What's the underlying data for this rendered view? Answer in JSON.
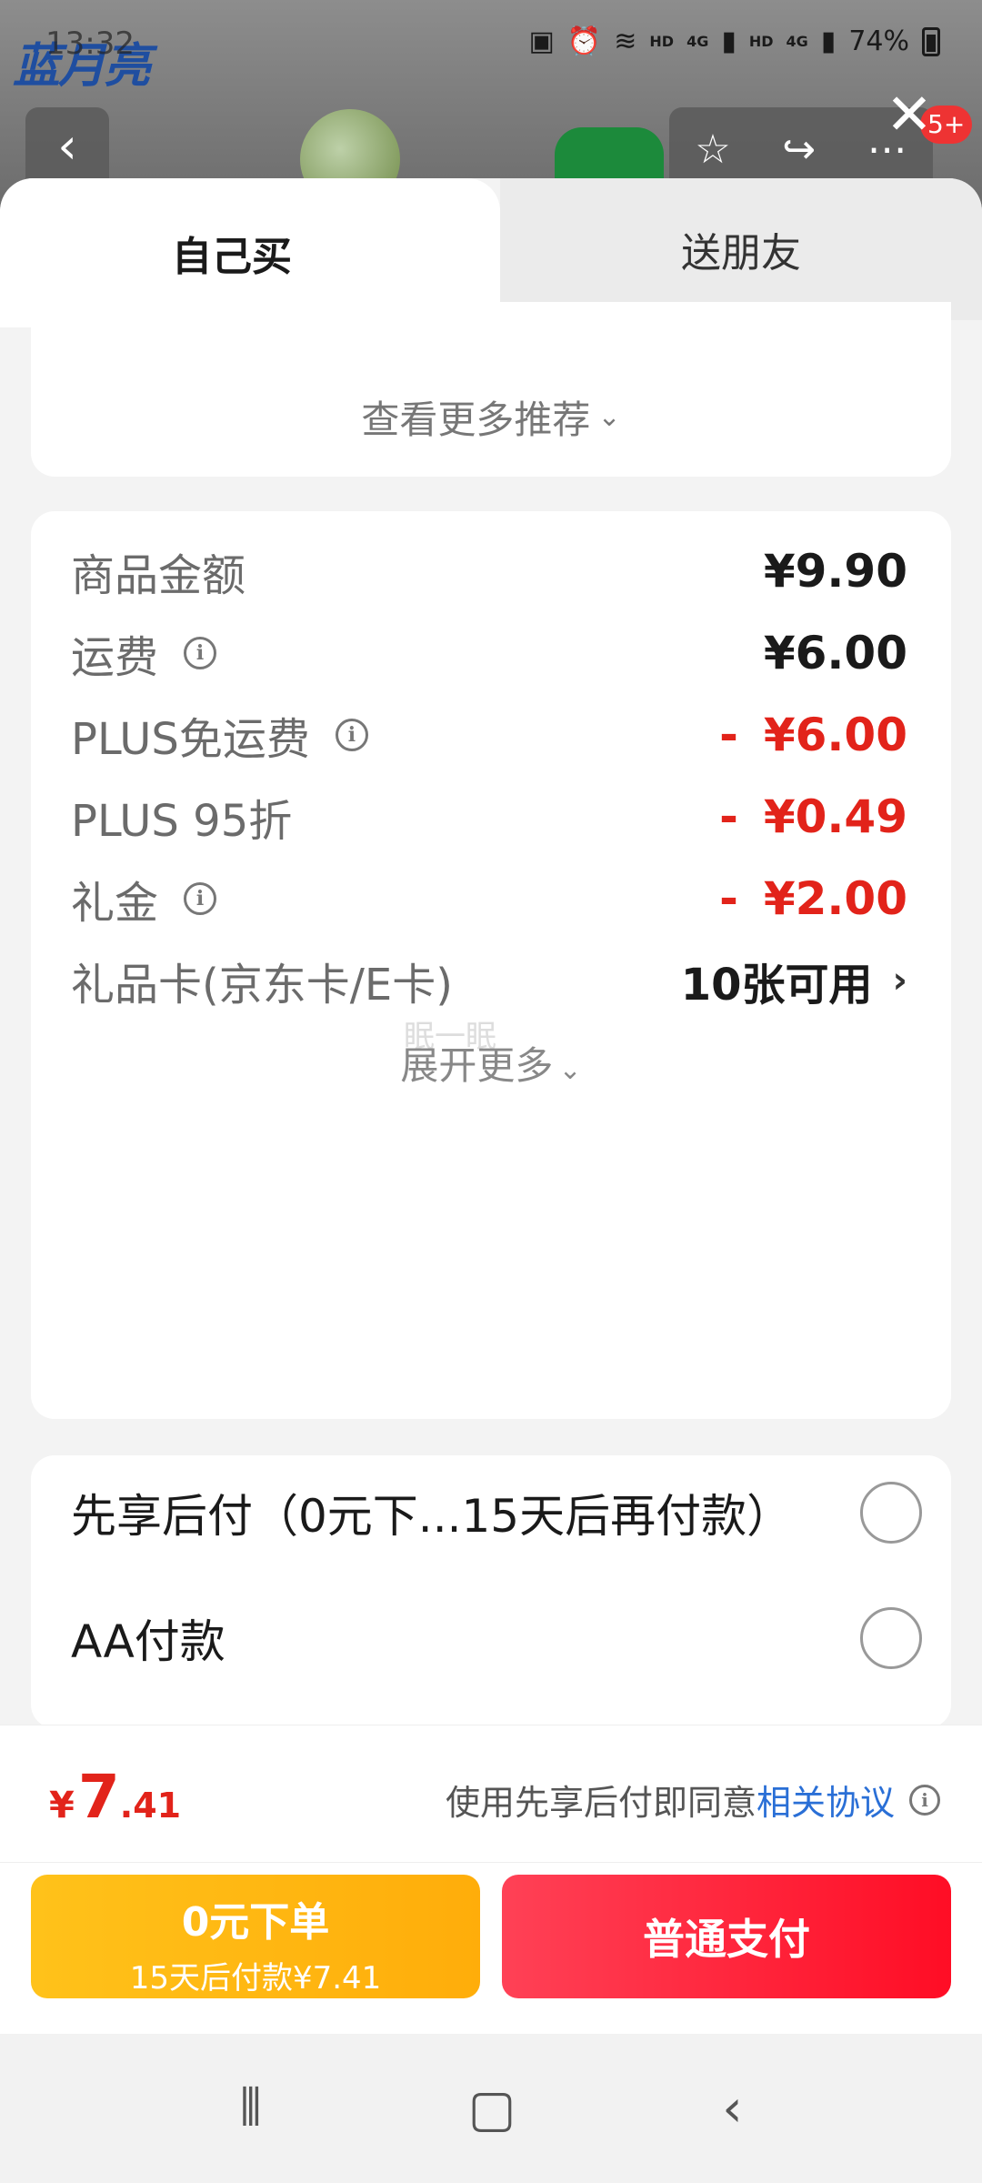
{
  "background": {
    "brand": "蓝月亮"
  },
  "status_bar": {
    "time": "13:32",
    "net_hd1": "HD",
    "net_4g1": "4G",
    "net_hd2": "HD",
    "net_4g2": "4G",
    "battery": "74%"
  },
  "top_actions": {
    "badge": "5+"
  },
  "tabs": {
    "self": "自己买",
    "friend": "送朋友"
  },
  "recommend": {
    "label": "查看更多推荐"
  },
  "price": {
    "rows": [
      {
        "label": "商品金额",
        "value": "¥9.90"
      },
      {
        "label": "运费",
        "value": "¥6.00"
      },
      {
        "label": "PLUS免运费",
        "value": "¥6.00"
      },
      {
        "label": "PLUS 95折",
        "value": "¥0.49"
      },
      {
        "label": "礼金",
        "value": "¥2.00"
      },
      {
        "label": "礼品卡(京东卡/E卡)",
        "value": "10张可用"
      }
    ],
    "minus": "-",
    "expand": "展开更多",
    "watermark": "眠一眠"
  },
  "payment": {
    "options": [
      {
        "label": "先享后付（0元下...15天后再付款）"
      },
      {
        "label": "AA付款"
      }
    ]
  },
  "bottom": {
    "currency": "¥",
    "total_int": "7",
    "total_dec": ".41",
    "agree_text": "使用先享后付即同意",
    "agree_link": "相关协议",
    "zero_title": "0元下单",
    "zero_sub": "15天后付款¥7.41",
    "pay_label": "普通支付"
  },
  "colors": {
    "accent_red": "#e2231a",
    "link_blue": "#2a6fd6",
    "btn_yellow": "#ffb80f",
    "btn_red": "#ff1f35"
  }
}
